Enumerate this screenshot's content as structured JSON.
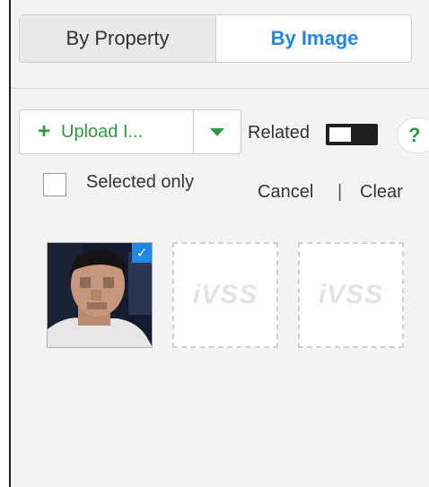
{
  "tabs": {
    "left_label": "By Property",
    "right_label": "By Image",
    "active": "By Image"
  },
  "toolbar": {
    "upload_label": "Upload I...",
    "related_label": "Related",
    "related_on": false,
    "help_glyph": "?"
  },
  "selection": {
    "selected_only_label": "Selected only",
    "selected_only_checked": false,
    "cancel_label": "Cancel",
    "separator": "|",
    "clear_label": "Clear"
  },
  "thumbnails": [
    {
      "type": "photo",
      "selected": true
    },
    {
      "type": "placeholder",
      "watermark": "iVSS"
    },
    {
      "type": "placeholder",
      "watermark": "iVSS"
    }
  ],
  "colors": {
    "accent_blue": "#1e88e5",
    "accent_green": "#2e9c3e"
  },
  "icons": {
    "add": "plus-icon",
    "dropdown": "chevron-down-icon",
    "help": "help-icon",
    "selected": "check-icon"
  }
}
